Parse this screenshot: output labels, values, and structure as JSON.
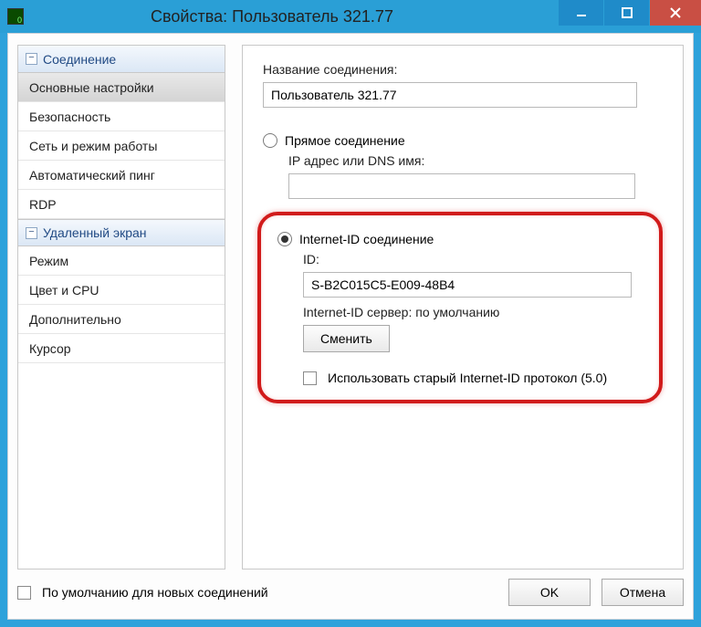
{
  "window": {
    "title": "Свойства: Пользователь 321.77"
  },
  "sidebar": {
    "groups": [
      {
        "label": "Соединение",
        "expander": "−",
        "items": [
          "Основные настройки",
          "Безопасность",
          "Сеть и режим работы",
          "Автоматический пинг",
          "RDP"
        ],
        "selected_index": 0
      },
      {
        "label": "Удаленный экран",
        "expander": "−",
        "items": [
          "Режим",
          "Цвет и CPU",
          "Дополнительно",
          "Курсор"
        ],
        "selected_index": -1
      }
    ]
  },
  "content": {
    "connection_name_label": "Название соединения:",
    "connection_name_value": "Пользователь 321.77",
    "direct_label": "Прямое соединение",
    "direct_checked": false,
    "ip_dns_label": "IP адрес или DNS имя:",
    "ip_dns_value": "",
    "internetid_label": "Internet-ID соединение",
    "internetid_checked": true,
    "id_label": "ID:",
    "id_value": "S-B2C015C5-E009-48B4",
    "server_label": "Internet-ID сервер: по умолчанию",
    "change_button": "Сменить",
    "old_protocol_label": "Использовать старый Internet-ID протокол (5.0)",
    "old_protocol_checked": false
  },
  "footer": {
    "default_checkbox_label": "По умолчанию для новых соединений",
    "default_checked": false,
    "ok": "OK",
    "cancel": "Отмена"
  }
}
